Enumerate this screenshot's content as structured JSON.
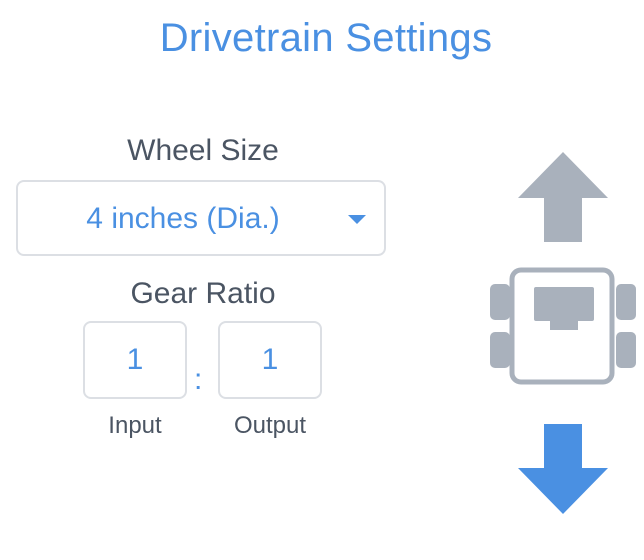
{
  "title": "Drivetrain Settings",
  "wheel_size": {
    "label": "Wheel Size",
    "selected": "4 inches (Dia.)",
    "caret_icon": "caret-down-icon"
  },
  "gear_ratio": {
    "label": "Gear Ratio",
    "input_value": "1",
    "separator": ":",
    "output_value": "1",
    "input_label": "Input",
    "output_label": "Output"
  },
  "icons": {
    "forward": "arrow-up-icon",
    "robot": "robot-top-view-icon",
    "reverse": "arrow-down-icon"
  },
  "colors": {
    "accent": "#4a90e2",
    "text": "#4b5563",
    "border": "#dcdfe4",
    "inactive_arrow": "#a9b1bc",
    "active_arrow": "#4a90e2"
  }
}
